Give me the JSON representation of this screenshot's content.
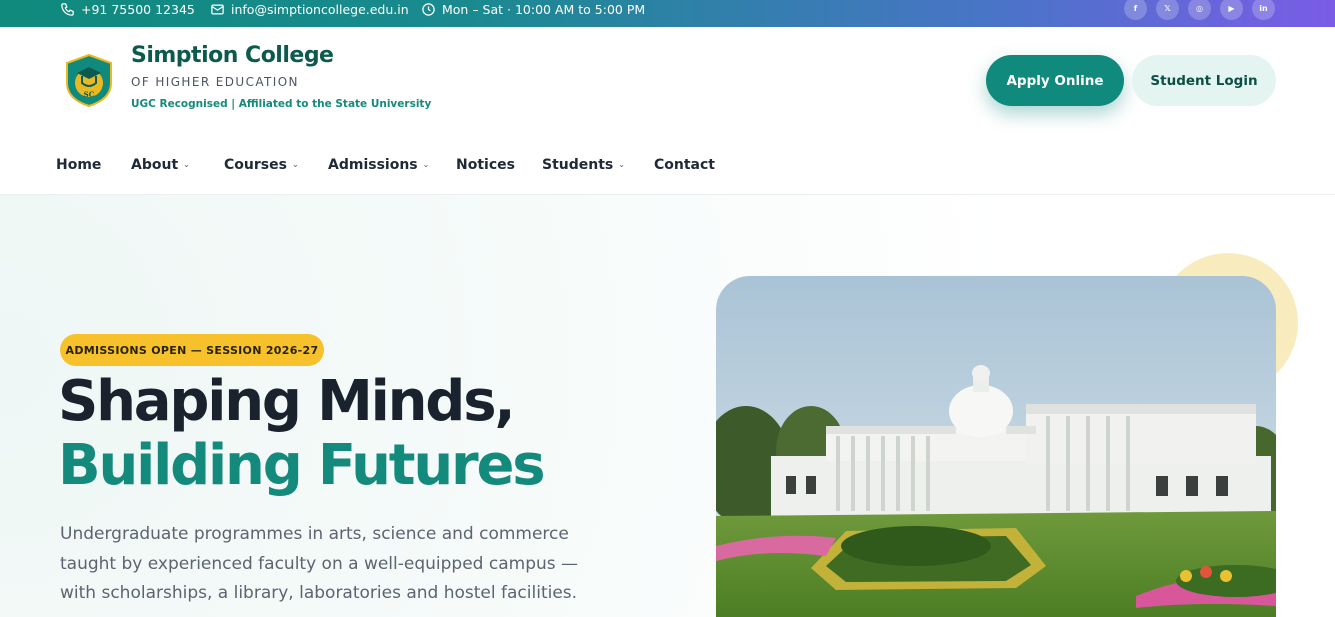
{
  "topbar": {
    "phone": "+91 75500 12345",
    "email": "info@simptioncollege.edu.in",
    "hours": "Mon – Sat · 10:00 AM to 5:00 PM",
    "social": [
      {
        "icon": "facebook-icon",
        "glyph": "f"
      },
      {
        "icon": "x-icon",
        "glyph": "𝕏"
      },
      {
        "icon": "instagram-icon",
        "glyph": "◎"
      },
      {
        "icon": "youtube-icon",
        "glyph": "▶"
      },
      {
        "icon": "linkedin-icon",
        "glyph": "in"
      }
    ]
  },
  "brand": {
    "logo_text": "SC",
    "name": "Simption College",
    "subtitle": "OF HIGHER EDUCATION",
    "tagline": "UGC Recognised | Affiliated to the State University"
  },
  "header": {
    "apply_label": "Apply Online",
    "login_label": "Student Login"
  },
  "nav": [
    {
      "label": "Home",
      "dropdown": false
    },
    {
      "label": "About",
      "dropdown": true
    },
    {
      "label": "Courses",
      "dropdown": true
    },
    {
      "label": "Admissions",
      "dropdown": true
    },
    {
      "label": "Notices",
      "dropdown": false
    },
    {
      "label": "Students",
      "dropdown": true
    },
    {
      "label": "Contact",
      "dropdown": false
    }
  ],
  "hero": {
    "badge": "ADMISSIONS OPEN — SESSION 2026-27",
    "headline_1": "Shaping Minds,",
    "headline_2": "Building Futures",
    "lead": "Undergraduate programmes in arts, science and commerce taught by experienced faculty on a well-equipped campus — with scholarships, a library, laboratories and hostel facilities."
  },
  "colors": {
    "primary": "#0f8a7c",
    "accent": "#f6c12a",
    "dark": "#1a222e"
  }
}
